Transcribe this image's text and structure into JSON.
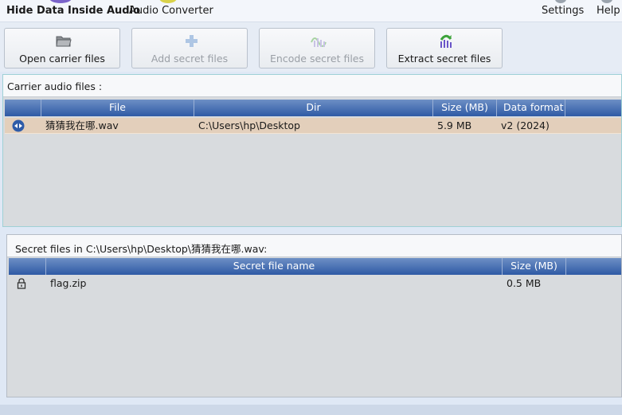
{
  "app": {
    "title": "Hide Data Inside Audio",
    "tab_converter": "Audio Converter",
    "settings_label": "Settings",
    "help_label": "Help"
  },
  "toolbar": {
    "open_carrier": "Open carrier files",
    "add_secret": "Add secret files",
    "encode_secret": "Encode secret files",
    "extract_secret": "Extract secret files"
  },
  "carrier": {
    "header": "Carrier audio files :",
    "columns": {
      "file": "File",
      "dir": "Dir",
      "size": "Size (MB)",
      "format": "Data format"
    },
    "rows": [
      {
        "file": "猜猜我在哪.wav",
        "dir": "C:\\Users\\hp\\Desktop",
        "size": "5.9 MB",
        "format": "v2 (2024)"
      }
    ]
  },
  "secret": {
    "header": "Secret files in C:\\Users\\hp\\Desktop\\猜猜我在哪.wav:",
    "columns": {
      "name": "Secret file name",
      "size": "Size (MB)"
    },
    "rows": [
      {
        "name": "flag.zip",
        "size": "0.5 MB"
      }
    ]
  },
  "colors": {
    "grid_header_top": "#6d8fc5",
    "grid_header_bottom": "#2e5aa5",
    "selected_row": "#e3cfbb",
    "panel_bg": "#d8dbde"
  },
  "icons": {
    "open_carrier": "folder-icon",
    "add_secret": "plus-icon",
    "encode_secret": "audio-wave-icon",
    "extract_secret": "audio-wave-arrow-icon",
    "carrier_row": "audio-file-icon",
    "secret_row": "lock-icon"
  }
}
